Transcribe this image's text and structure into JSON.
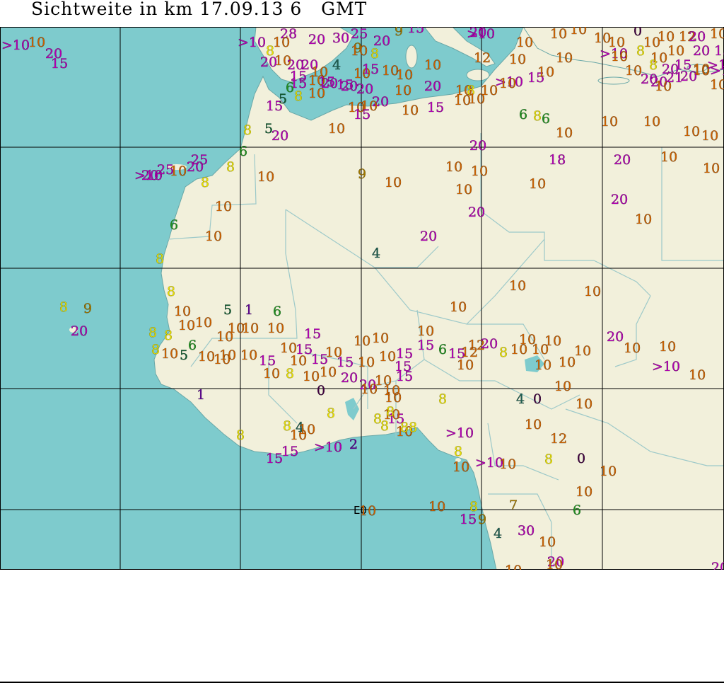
{
  "title": "Sichtweite in km 17.09.13 6   GMT",
  "colors": {
    "ocean": "#7ecbcd",
    "land": "#f2f0db",
    "border": "#9dc9c9",
    "grid": "#000000",
    "class_gt10": "#b000b0",
    "class_20": "#b000b0",
    "class_15": "#b000b0",
    "class_10": "#c86000",
    "class_9": "#a07800",
    "class_8": "#e8e000",
    "class_6": "#208f20",
    "class_5": "#105a30",
    "class_4": "#1e5e50",
    "class_1": "#5a0090",
    "class_0": "#400040"
  },
  "grid_label": "E0",
  "observations": [
    [
      "10",
      "#c86000"
    ],
    [
      ">10",
      "#b000b0"
    ],
    [
      "20",
      "#b000b0"
    ],
    [
      "15",
      "#b000b0"
    ],
    [
      ">10",
      "#b000b0"
    ],
    [
      "8",
      "#e8e000"
    ],
    [
      "28",
      "#b000b0"
    ],
    [
      "10",
      "#c86000"
    ],
    [
      "20",
      "#b000b0"
    ],
    [
      "30",
      "#b000b0"
    ],
    [
      "25",
      "#b000b0"
    ],
    [
      "20",
      "#b000b0"
    ],
    [
      "9",
      "#a07800"
    ],
    [
      "15",
      "#b000b0"
    ],
    [
      "20",
      "#b000b0"
    ],
    [
      "10",
      "#c86000"
    ],
    [
      "10",
      "#c86000"
    ],
    [
      "10",
      "#c86000"
    ],
    [
      "0",
      "#400040"
    ],
    [
      "10",
      "#c86000"
    ],
    [
      "12",
      "#c86000"
    ],
    [
      "20",
      "#b000b0"
    ],
    [
      "10",
      "#c86000"
    ],
    [
      "20",
      "#b000b0"
    ],
    [
      "10",
      "#c86000"
    ],
    [
      "9",
      "#a07800"
    ],
    [
      "8",
      "#e8e000"
    ],
    [
      ">10",
      "#b000b0"
    ],
    [
      "10",
      "#c86000"
    ],
    [
      "10",
      "#c86000"
    ],
    [
      "10",
      "#c86000"
    ],
    [
      ">10",
      "#b000b0"
    ],
    [
      "20",
      "#b000b0"
    ],
    [
      "20",
      "#b000b0"
    ],
    [
      "20",
      "#b000b0"
    ],
    [
      "4",
      "#1e5e50"
    ],
    [
      "10",
      "#c86000"
    ],
    [
      "15",
      "#b000b0"
    ],
    [
      "10",
      "#c86000"
    ],
    [
      "10",
      "#c86000"
    ],
    [
      "12",
      "#c86000"
    ],
    [
      "10",
      "#c86000"
    ],
    [
      "10",
      "#c86000"
    ],
    [
      "10",
      "#c86000"
    ],
    [
      "15",
      "#b000b0"
    ],
    [
      "20",
      "#b000b0"
    ],
    [
      ">10",
      "#b000b0"
    ],
    [
      "10",
      "#c86000"
    ],
    [
      "15",
      "#b000b0"
    ],
    [
      "6",
      "#208f20"
    ],
    [
      "10",
      "#c86000"
    ],
    [
      "15",
      "#b000b0"
    ],
    [
      "15",
      "#b000b0"
    ],
    [
      "10",
      "#c86000"
    ],
    [
      "15",
      "#b000b0"
    ],
    [
      "10",
      "#c86000"
    ],
    [
      "10",
      "#c86000"
    ],
    [
      ">10",
      "#b000b0"
    ],
    [
      "15",
      "#b000b0"
    ],
    [
      "10",
      "#c86000"
    ],
    [
      "20",
      "#b000b0"
    ],
    [
      "15",
      "#b000b0"
    ],
    [
      "5",
      "#105a30"
    ],
    [
      "8",
      "#e8e000"
    ],
    [
      "10",
      "#c86000"
    ],
    [
      "20",
      "#b000b0"
    ],
    [
      "20",
      "#b000b0"
    ],
    [
      "10",
      "#c86000"
    ],
    [
      "20",
      "#b000b0"
    ],
    [
      "10",
      "#c86000"
    ],
    [
      "8",
      "#e8e000"
    ],
    [
      "10",
      "#c86000"
    ],
    [
      "10",
      "#c86000"
    ],
    [
      "20",
      "#b000b0"
    ],
    [
      "20",
      "#b000b0"
    ],
    [
      "10",
      "#c86000"
    ],
    [
      "10",
      "#c86000"
    ],
    [
      "15",
      "#b000b0"
    ],
    [
      "10",
      "#c86000"
    ],
    [
      "15",
      "#b000b0"
    ],
    [
      "10",
      "#c86000"
    ],
    [
      "10",
      "#c86000"
    ],
    [
      "6",
      "#208f20"
    ],
    [
      "8",
      "#e8e000"
    ],
    [
      "6",
      "#208f20"
    ],
    [
      "10",
      "#c86000"
    ],
    [
      "10",
      "#c86000"
    ],
    [
      "10",
      "#c86000"
    ],
    [
      "10",
      "#c86000"
    ],
    [
      "10",
      "#c86000"
    ],
    [
      "8",
      "#e8e000"
    ],
    [
      "5",
      "#105a30"
    ],
    [
      "20",
      "#b000b0"
    ],
    [
      "10",
      "#c86000"
    ],
    [
      "20",
      "#b000b0"
    ],
    [
      "20",
      "#b000b0"
    ],
    [
      "25",
      "#b000b0"
    ],
    [
      ">10",
      "#b000b0"
    ],
    [
      "25",
      "#b000b0"
    ],
    [
      "10",
      "#c86000"
    ],
    [
      "20",
      "#b000b0"
    ],
    [
      "8",
      "#e8e000"
    ],
    [
      "6",
      "#208f20"
    ],
    [
      "10",
      "#c86000"
    ],
    [
      "9",
      "#a07800"
    ],
    [
      "10",
      "#c86000"
    ],
    [
      "10",
      "#c86000"
    ],
    [
      "10",
      "#c86000"
    ],
    [
      "10",
      "#c86000"
    ],
    [
      "18",
      "#b000b0"
    ],
    [
      "20",
      "#b000b0"
    ],
    [
      "10",
      "#c86000"
    ],
    [
      "10",
      "#c86000"
    ],
    [
      "8",
      "#e8e000"
    ],
    [
      "10",
      "#c86000"
    ],
    [
      "10",
      "#c86000"
    ],
    [
      "20",
      "#b000b0"
    ],
    [
      "20",
      "#b000b0"
    ],
    [
      "10",
      "#c86000"
    ],
    [
      "6",
      "#208f20"
    ],
    [
      "10",
      "#c86000"
    ],
    [
      "20",
      "#b000b0"
    ],
    [
      "8",
      "#e8e000"
    ],
    [
      "4",
      "#1e5e50"
    ],
    [
      "8",
      "#e8e000"
    ],
    [
      "9",
      "#a07800"
    ],
    [
      "8",
      "#e8e000"
    ],
    [
      "10",
      "#c86000"
    ],
    [
      "5",
      "#105a30"
    ],
    [
      "1",
      "#5a0090"
    ],
    [
      "6",
      "#208f20"
    ],
    [
      "10",
      "#c86000"
    ],
    [
      "10",
      "#c86000"
    ],
    [
      "10",
      "#c86000"
    ],
    [
      "20",
      "#b000b0"
    ],
    [
      "8",
      "#e8e000"
    ],
    [
      "8",
      "#e8e000"
    ],
    [
      "10",
      "#c86000"
    ],
    [
      "10",
      "#c86000"
    ],
    [
      "10",
      "#c86000"
    ],
    [
      "10",
      "#c86000"
    ],
    [
      "10",
      "#c86000"
    ],
    [
      "10",
      "#c86000"
    ],
    [
      "15",
      "#b000b0"
    ],
    [
      "10",
      "#c86000"
    ],
    [
      "10",
      "#c86000"
    ],
    [
      "10",
      "#c86000"
    ],
    [
      "12",
      "#c86000"
    ],
    [
      "20",
      "#b000b0"
    ],
    [
      "20",
      "#b000b0"
    ],
    [
      "10",
      "#c86000"
    ],
    [
      "10",
      "#c86000"
    ],
    [
      "8",
      "#e8e000"
    ],
    [
      "10",
      "#c86000"
    ],
    [
      "5",
      "#105a30"
    ],
    [
      "6",
      "#208f20"
    ],
    [
      "10",
      "#c86000"
    ],
    [
      "10",
      "#c86000"
    ],
    [
      "10",
      "#c86000"
    ],
    [
      "10",
      "#c86000"
    ],
    [
      "15",
      "#b000b0"
    ],
    [
      "10",
      "#c86000"
    ],
    [
      "15",
      "#b000b0"
    ],
    [
      "10",
      "#c86000"
    ],
    [
      "15",
      "#b000b0"
    ],
    [
      "10",
      "#c86000"
    ],
    [
      "15",
      "#b000b0"
    ],
    [
      "10",
      "#c86000"
    ],
    [
      "10",
      "#c86000"
    ],
    [
      "15",
      "#b000b0"
    ],
    [
      "15",
      "#b000b0"
    ],
    [
      "15",
      "#b000b0"
    ],
    [
      "6",
      "#208f20"
    ],
    [
      "15",
      "#b000b0"
    ],
    [
      "12",
      "#c86000"
    ],
    [
      "8",
      "#e8e000"
    ],
    [
      "10",
      "#c86000"
    ],
    [
      "10",
      "#c86000"
    ],
    [
      "10",
      "#c86000"
    ],
    [
      "10",
      "#c86000"
    ],
    [
      "10",
      "#c86000"
    ],
    [
      "10",
      "#c86000"
    ],
    [
      "10",
      "#c86000"
    ],
    [
      "10",
      "#c86000"
    ],
    [
      "8",
      "#e8e000"
    ],
    [
      "10",
      "#c86000"
    ],
    [
      "10",
      "#c86000"
    ],
    [
      "20",
      "#b000b0"
    ],
    [
      "20",
      "#b000b0"
    ],
    [
      "15",
      "#b000b0"
    ],
    [
      "8",
      "#e8e000"
    ],
    [
      "10",
      "#c86000"
    ],
    [
      ">10",
      "#b000b0"
    ],
    [
      "10",
      "#c86000"
    ],
    [
      "0",
      "#400040"
    ],
    [
      "10",
      "#c86000"
    ],
    [
      "10",
      "#c86000"
    ],
    [
      "10",
      "#c86000"
    ],
    [
      "10",
      "#c86000"
    ],
    [
      "15",
      "#b000b0"
    ],
    [
      "8",
      "#e8e000"
    ],
    [
      "4",
      "#1e5e50"
    ],
    [
      "0",
      "#400040"
    ],
    [
      "10",
      "#c86000"
    ],
    [
      "10",
      "#c86000"
    ],
    [
      "1",
      "#5a0090"
    ],
    [
      "8",
      "#e8e000"
    ],
    [
      "8",
      "#e8e000"
    ],
    [
      "10",
      "#c86000"
    ],
    [
      "8",
      "#e8e000"
    ],
    [
      "10",
      "#c86000"
    ],
    [
      "8",
      "#e8e000"
    ],
    [
      "8",
      "#e8e000"
    ],
    [
      "10",
      "#c86000"
    ],
    [
      "4",
      "#1e5e50"
    ],
    [
      "10",
      "#c86000"
    ],
    [
      "10",
      "#c86000"
    ],
    [
      "88",
      "#e8e000"
    ],
    [
      ">10",
      "#b000b0"
    ],
    [
      "12",
      "#c86000"
    ],
    [
      "15",
      "#b000b0"
    ],
    [
      "15",
      "#b000b0"
    ],
    [
      ">10",
      "#b000b0"
    ],
    [
      "2",
      "#5a0090"
    ],
    [
      "8",
      "#e8e000"
    ],
    [
      "8",
      "#e8e000"
    ],
    [
      "0",
      "#400040"
    ],
    [
      "10",
      "#c86000"
    ],
    [
      ">10",
      "#b000b0"
    ],
    [
      "10",
      "#c86000"
    ],
    [
      "10",
      "#c86000"
    ],
    [
      "10",
      "#c86000"
    ],
    [
      "10",
      "#c86000"
    ],
    [
      "10",
      "#c86000"
    ],
    [
      "8",
      "#e8e000"
    ],
    [
      "15",
      "#b000b0"
    ],
    [
      "9",
      "#a07800"
    ],
    [
      "7",
      "#a07800"
    ],
    [
      "6",
      "#208f20"
    ],
    [
      "4",
      "#1e5e50"
    ],
    [
      "30",
      "#b000b0"
    ],
    [
      "10",
      "#c86000"
    ],
    [
      "10",
      "#c86000"
    ],
    [
      "20",
      "#b000b0"
    ],
    [
      "10",
      "#c86000"
    ],
    [
      "20",
      "#b000b0"
    ],
    [
      "20",
      "#b000b0"
    ],
    [
      "10",
      "#c86000"
    ],
    [
      "21",
      "#b000b0"
    ],
    [
      "20",
      "#b000b0"
    ],
    [
      "10",
      "#c86000"
    ],
    [
      ">10",
      "#b000b0"
    ],
    [
      "15",
      "#b000b0"
    ],
    [
      "10",
      "#c86000"
    ],
    [
      "10",
      "#c86000"
    ],
    [
      "10",
      "#c86000"
    ],
    [
      "8",
      "#e8e000"
    ],
    [
      "8",
      "#e8e000"
    ],
    [
      "10",
      "#c86000"
    ]
  ]
}
